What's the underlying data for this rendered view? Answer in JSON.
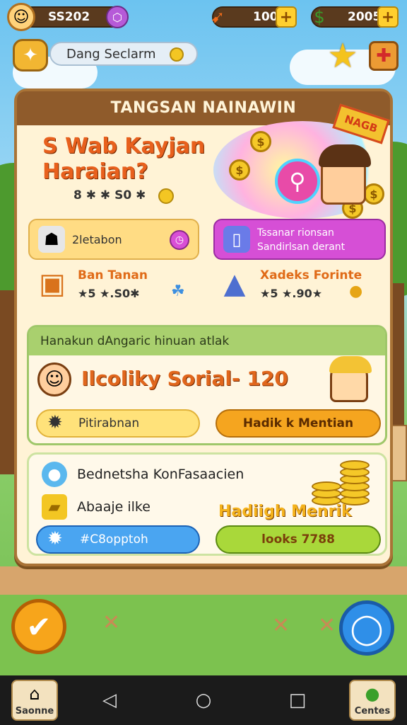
{
  "hud": {
    "player_coins": "SS202",
    "energy": "100",
    "cash": "2005",
    "avatar_icon": "player-avatar",
    "gem_icon": "gem-icon",
    "energy_icon": "lightning-icon",
    "cash_icon": "cash-icon"
  },
  "location": {
    "label": "Dang Seclarm"
  },
  "panel": {
    "title": "TANGSAN NAINAWIN",
    "promo": {
      "title": "S Wab Kayjan Haraian?",
      "stats": "8 ✱ ✱ S0 ✱",
      "badge": "NAGB"
    },
    "card_a": {
      "label": "2letabon"
    },
    "card_b": {
      "label": "Tssanar rionsan Sandirlsan derant"
    },
    "reward_1": {
      "title": "Ban Tanan",
      "value": "★5 ★.S0✱"
    },
    "reward_2": {
      "title": "Xadeks Forinte",
      "value": "★5 ★.90★"
    }
  },
  "social_section": {
    "header": "Hanakun dAngaric hinuan atlak",
    "title": "Ilcoliky Sorial- 120",
    "left_button": "Pitirabnan",
    "right_button": "Hadik k Mentian"
  },
  "info_section": {
    "row_1": "Bednetsha KonFasaacien",
    "row_2": "Abaaje ilke",
    "reward_label": "Hadiigh Menrik",
    "left_button": "#C8opptoh",
    "right_button": "looks 7788"
  },
  "navbar": {
    "left_label": "Saonne",
    "right_label": "Centes"
  },
  "colors": {
    "panel_bg": "#fff3d6",
    "panel_border": "#a97336",
    "accent_orange": "#e8601d",
    "accent_green": "#a9d06e"
  }
}
